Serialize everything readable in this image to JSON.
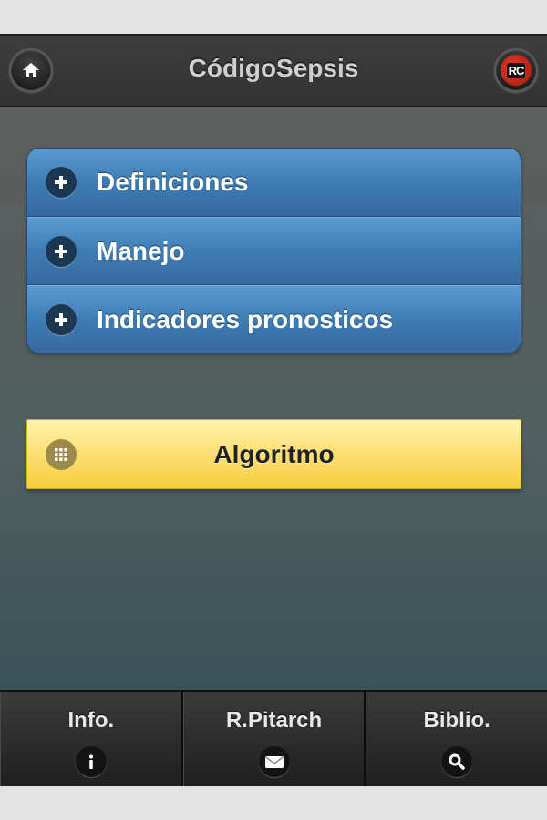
{
  "header": {
    "title": "CódigoSepsis",
    "left_icon": "home-icon",
    "right_icon": "rc-brand-icon",
    "brand_text": "RC"
  },
  "menu": {
    "items": [
      {
        "label": "Definiciones",
        "icon": "plus-icon"
      },
      {
        "label": "Manejo",
        "icon": "plus-icon"
      },
      {
        "label": "Indicadores pronosticos",
        "icon": "plus-icon"
      }
    ]
  },
  "algorithm_button": {
    "label": "Algoritmo",
    "icon": "grid-icon"
  },
  "footer": {
    "tabs": [
      {
        "label": "Info.",
        "icon": "info-icon"
      },
      {
        "label": "R.Pitarch",
        "icon": "mail-icon"
      },
      {
        "label": "Biblio.",
        "icon": "search-icon"
      }
    ]
  },
  "colors": {
    "menu_blue": "#3f7cb4",
    "button_yellow": "#fde07a",
    "bar_dark": "#2f2f2f"
  }
}
